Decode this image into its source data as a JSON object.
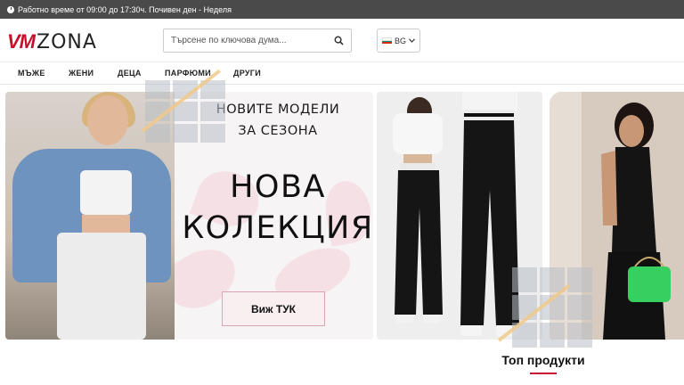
{
  "topbar": {
    "text": "Работно време от 09:00 до 17:30ч. Почивен ден - Неделя"
  },
  "logo": {
    "part1": "VM",
    "part2": "ZONA"
  },
  "search": {
    "placeholder": "Търсене по ключова дума..."
  },
  "language": {
    "selected": "BG"
  },
  "nav": {
    "items": [
      {
        "label": "МЪЖЕ"
      },
      {
        "label": "ЖЕНИ"
      },
      {
        "label": "ДЕЦА"
      },
      {
        "label": "ПАРФЮМИ"
      },
      {
        "label": "ДРУГИ"
      }
    ]
  },
  "banner": {
    "tagline_line1": "НОВИТЕ МОДЕЛИ",
    "tagline_line2": "ЗА СЕЗОНА",
    "headline_line1": "НОВА",
    "headline_line2": "КОЛЕКЦИЯ",
    "cta_label": "Виж ТУК"
  },
  "products": {
    "section_title": "Топ продукти"
  },
  "colors": {
    "brand_red": "#c8102e",
    "topbar_bg": "#4a4a4a"
  },
  "icons": {
    "search": "search-icon",
    "clock": "clock-icon",
    "flag": "bulgaria-flag-icon"
  }
}
